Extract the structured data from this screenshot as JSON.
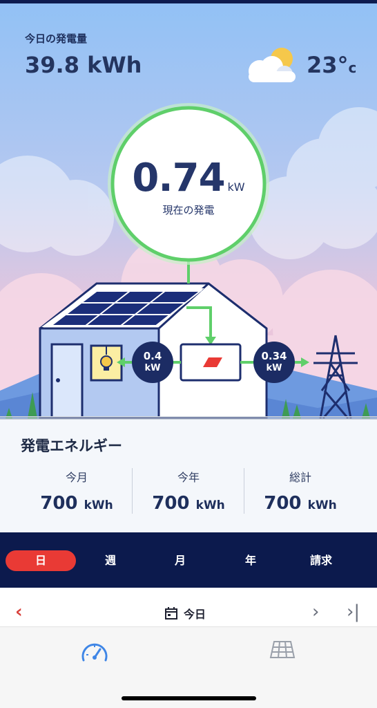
{
  "header": {
    "label": "今日の発電量",
    "value": "39.8 kWh",
    "temperature": "23°",
    "temperature_unit": "c",
    "weather_icon": "partly-cloudy-icon"
  },
  "gauge": {
    "value": "0.74",
    "unit": "kW",
    "label": "現在の発電"
  },
  "flows": {
    "home": {
      "value": "0.4",
      "unit": "kW"
    },
    "grid": {
      "value": "0.34",
      "unit": "kW"
    }
  },
  "energy": {
    "title": "発電エネルギー",
    "stats": [
      {
        "label": "今月",
        "value": "700",
        "unit": "kWh"
      },
      {
        "label": "今年",
        "value": "700",
        "unit": "kWh"
      },
      {
        "label": "総計",
        "value": "700",
        "unit": "kWh"
      }
    ]
  },
  "periods": {
    "tabs": [
      "日",
      "週",
      "月",
      "年",
      "請求"
    ],
    "active_index": 0
  },
  "date_nav": {
    "label": "今日",
    "prev_icon": "chevron-left-icon",
    "next_icon": "chevron-right-icon",
    "last_icon": "skip-to-end-icon"
  },
  "tabbar": {
    "items": [
      {
        "icon": "speedometer-icon",
        "active": true
      },
      {
        "icon": "solar-panel-icon",
        "active": false
      }
    ]
  },
  "colors": {
    "accent": "#e93a35",
    "navy": "#0c1a4d",
    "flow_green": "#5fcf6a",
    "active_tab_icon": "#3f86e6"
  }
}
